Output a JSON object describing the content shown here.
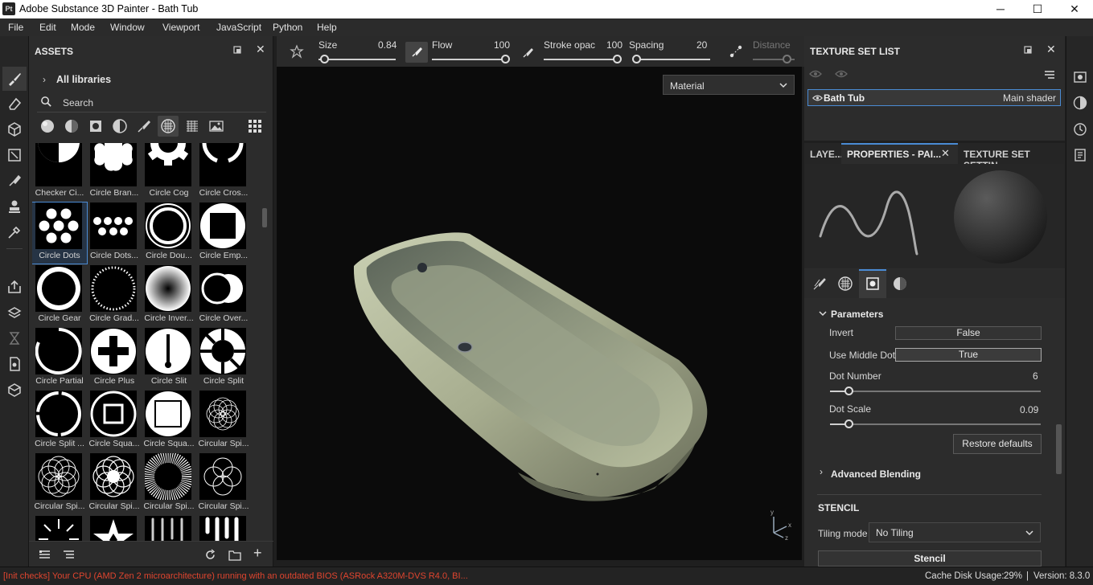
{
  "window": {
    "icon_text": "Pt",
    "title": "Adobe Substance 3D Painter - Bath Tub",
    "minimize": "─",
    "maximize": "☐",
    "close": "✕"
  },
  "menu": [
    "File",
    "Edit",
    "Mode",
    "Window",
    "Viewport",
    "JavaScript",
    "Python",
    "Help"
  ],
  "assets": {
    "title": "ASSETS",
    "breadcrumb": "All libraries",
    "search_placeholder": "Search",
    "filter_icons": [
      "material-ball-icon",
      "smart-material-icon",
      "mask-icon",
      "filter-icon",
      "brush-icon",
      "alpha-icon",
      "texture-icon",
      "environment-icon",
      "grid-view-icon"
    ],
    "items": [
      {
        "label": "Checker Ci...",
        "shape": "checker"
      },
      {
        "label": "Circle Bran...",
        "shape": "branch"
      },
      {
        "label": "Circle Cog",
        "shape": "cog"
      },
      {
        "label": "Circle Cros...",
        "shape": "cross"
      },
      {
        "label": "Circle Dots",
        "shape": "dots",
        "selected": true
      },
      {
        "label": "Circle Dots...",
        "shape": "dotsrow"
      },
      {
        "label": "Circle Dou...",
        "shape": "double"
      },
      {
        "label": "Circle Emp...",
        "shape": "empty"
      },
      {
        "label": "Circle Gear",
        "shape": "gear"
      },
      {
        "label": "Circle Grad...",
        "shape": "grad"
      },
      {
        "label": "Circle Inver...",
        "shape": "invert"
      },
      {
        "label": "Circle Over...",
        "shape": "over"
      },
      {
        "label": "Circle Partial",
        "shape": "partial"
      },
      {
        "label": "Circle Plus",
        "shape": "plus"
      },
      {
        "label": "Circle Slit",
        "shape": "slit"
      },
      {
        "label": "Circle Split",
        "shape": "split"
      },
      {
        "label": "Circle Split ...",
        "shape": "split2"
      },
      {
        "label": "Circle Squa...",
        "shape": "square"
      },
      {
        "label": "Circle Squa...",
        "shape": "square2"
      },
      {
        "label": "Circular Spi...",
        "shape": "spiro"
      },
      {
        "label": "Circular Spi...",
        "shape": "spiro2"
      },
      {
        "label": "Circular Spi...",
        "shape": "spiro3"
      },
      {
        "label": "Circular Spi...",
        "shape": "spiro4"
      },
      {
        "label": "Circular Spi...",
        "shape": "spiro5"
      },
      {
        "label": "",
        "shape": "burst"
      },
      {
        "label": "",
        "shape": "star"
      },
      {
        "label": "",
        "shape": "drips"
      },
      {
        "label": "",
        "shape": "drips2"
      }
    ]
  },
  "toolbar": {
    "size_label": "Size",
    "size_value": "0.84",
    "size_level": 0.08,
    "flow_label": "Flow",
    "flow_value": "100",
    "flow_level": 1.0,
    "stroke_label": "Stroke opac",
    "stroke_value": "100",
    "stroke_level": 1.0,
    "spacing_label": "Spacing",
    "spacing_value": "20",
    "spacing_level": 0.05,
    "distance_label": "Distance"
  },
  "viewport": {
    "display_mode": "Material",
    "gizmo_x": "x",
    "gizmo_y": "y",
    "gizmo_z": "z"
  },
  "texture_set_list": {
    "title": "TEXTURE SET LIST",
    "set_name": "Bath Tub",
    "shader": "Main shader"
  },
  "properties": {
    "tabs": [
      "LAYE...",
      "PROPERTIES - PAI...",
      "TEXTURE SET SETTIN..."
    ],
    "tab_close": "✕",
    "section_parameters": "Parameters",
    "invert_label": "Invert",
    "invert_value": "False",
    "middle_dot_label": "Use Middle Dot",
    "middle_dot_value": "True",
    "dot_number_label": "Dot Number",
    "dot_number_value": "6",
    "dot_number_level": 0.09,
    "dot_scale_label": "Dot Scale",
    "dot_scale_value": "0.09",
    "dot_scale_level": 0.09,
    "restore_label": "Restore defaults",
    "advanced_label": "Advanced Blending",
    "stencil_title": "STENCIL",
    "tiling_label": "Tiling mode",
    "tiling_value": "No Tiling",
    "stencil_button": "Stencil"
  },
  "status": {
    "warning": "[Init checks] Your CPU (AMD Zen 2 microarchitecture) running with an outdated BIOS (ASRock A320M-DVS R4.0, BI...",
    "cache": "Cache Disk Usage:",
    "cache_value": "29%",
    "separator": "|",
    "version": "Version: 8.3.0",
    "warning_color": "#e0452f"
  }
}
